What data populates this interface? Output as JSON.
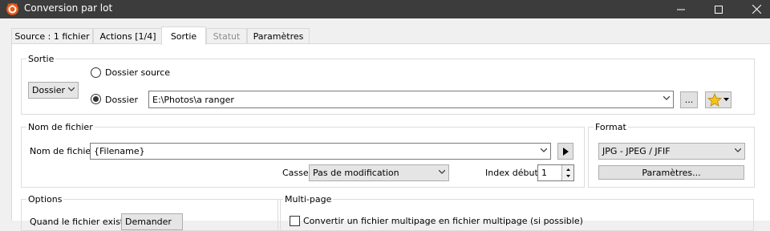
{
  "window": {
    "title": "Conversion par lot"
  },
  "tabs": [
    {
      "label": "Source : 1 fichier",
      "state": "normal"
    },
    {
      "label": "Actions [1/4]",
      "state": "normal"
    },
    {
      "label": "Sortie",
      "state": "active"
    },
    {
      "label": "Statut",
      "state": "disabled"
    },
    {
      "label": "Paramètres",
      "state": "normal"
    }
  ],
  "sortie": {
    "group_label": "Sortie",
    "mode_value": "Dossier",
    "radio_source_label": "Dossier source",
    "radio_folder_label": "Dossier",
    "selected": "Dossier",
    "folder_path": "E:\\Photos\\a ranger",
    "browse_label": "..."
  },
  "nom_fichier": {
    "group_label": "Nom de fichier",
    "field_label": "Nom de fichier",
    "field_value": "{Filename}",
    "case_label": "Casse",
    "case_value": "Pas de modification",
    "index_label": "Index début",
    "index_value": "1"
  },
  "format": {
    "group_label": "Format",
    "value": "JPG - JPEG / JFIF",
    "params_label": "Paramètres..."
  },
  "options": {
    "group_label": "Options",
    "partial_label": "Quand le fichier existe",
    "partial_value": "Demander"
  },
  "multipage": {
    "group_label": "Multi-page",
    "checkbox_label": "Convertir un fichier multipage en fichier multipage (si possible)"
  },
  "colors": {
    "titlebar": "#3c3c3c",
    "star": "#f5c518",
    "panel": "#ffffff"
  }
}
